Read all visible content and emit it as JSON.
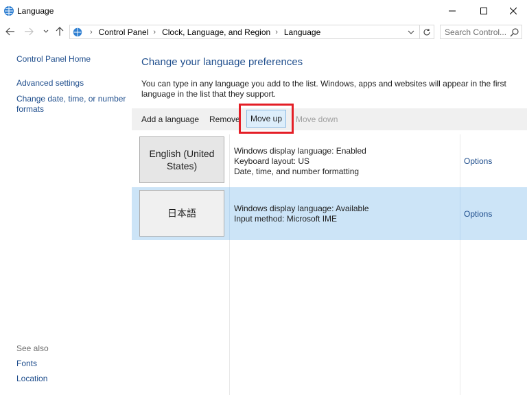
{
  "window": {
    "title": "Language",
    "controls": [
      "minimize-icon",
      "maximize-icon",
      "close-icon"
    ]
  },
  "address_bar": {
    "breadcrumbs": [
      "Control Panel",
      "Clock, Language, and Region",
      "Language"
    ],
    "search_placeholder": "Search Control..."
  },
  "sidebar": {
    "home": "Control Panel Home",
    "links": [
      "Advanced settings",
      "Change date, time, or number formats"
    ],
    "see_also_label": "See also",
    "see_also": [
      "Fonts",
      "Location"
    ]
  },
  "main": {
    "heading": "Change your language preferences",
    "intro": "You can type in any language you add to the list. Windows, apps and websites will appear in the first language in the list that they support.",
    "toolbar": {
      "add": "Add a language",
      "remove": "Remove",
      "move_up": "Move up",
      "move_down": "Move down"
    },
    "languages": [
      {
        "name": "English (United States)",
        "details": [
          "Windows display language: Enabled",
          "Keyboard layout: US",
          "Date, time, and number formatting"
        ],
        "options": "Options",
        "selected": false
      },
      {
        "name": "日本語",
        "details": [
          "Windows display language: Available",
          "Input method: Microsoft IME"
        ],
        "options": "Options",
        "selected": true
      }
    ]
  },
  "colors": {
    "link": "#1e4d8c",
    "selected_row": "#cce4f7",
    "highlight": "#e41e26"
  }
}
